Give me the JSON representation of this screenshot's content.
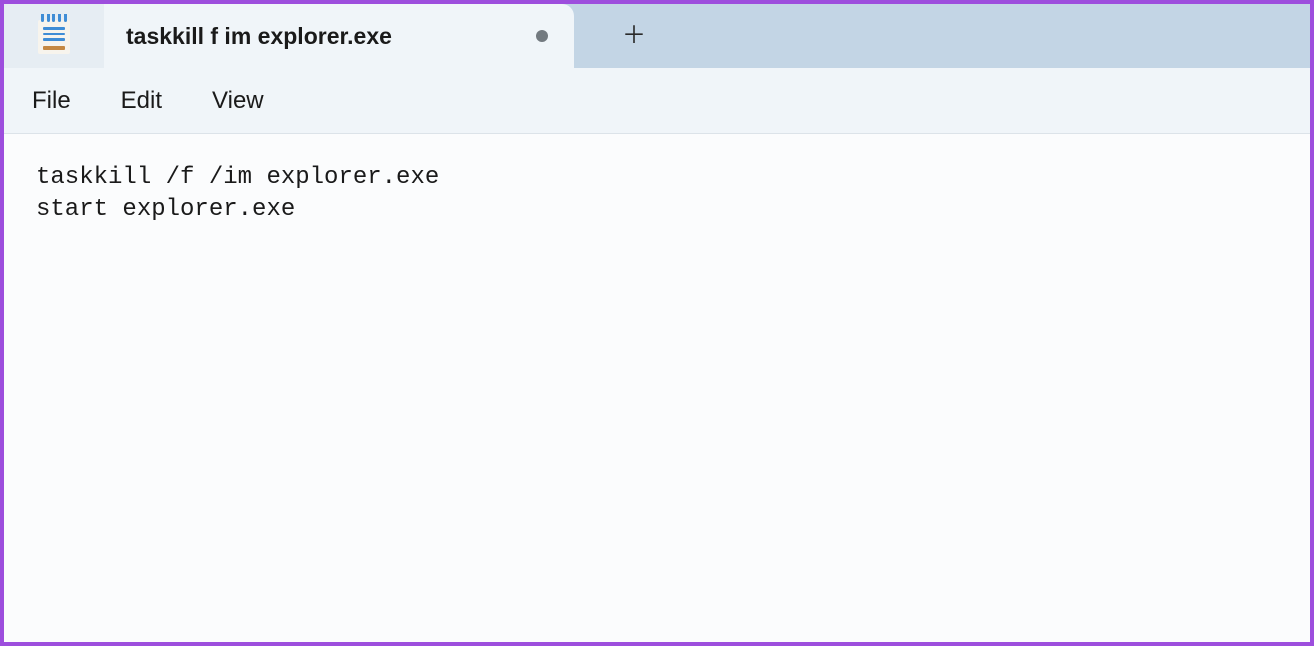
{
  "tab": {
    "title": "taskkill f im explorer.exe",
    "modified": true
  },
  "menu": {
    "file": "File",
    "edit": "Edit",
    "view": "View"
  },
  "editor": {
    "content": "taskkill /f /im explorer.exe\nstart explorer.exe"
  }
}
